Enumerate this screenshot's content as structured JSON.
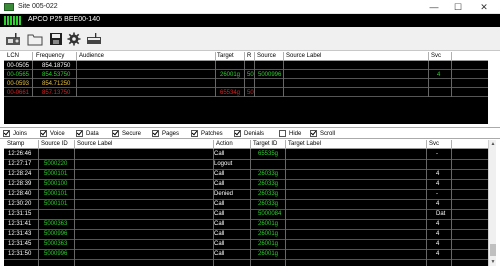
{
  "window": {
    "title": "Site 005-022",
    "minimize": "—",
    "maximize": "☐",
    "close": "✕"
  },
  "header": {
    "system": "APCO P25 BEE00-140"
  },
  "toolbar": {
    "buttons": [
      "radio-icon",
      "open-folder-icon",
      "save-disk-icon",
      "settings-gear-icon",
      "scanner-icon"
    ]
  },
  "channels": {
    "columns": [
      "LCN",
      "Frequency",
      "Audience",
      "Target",
      "R",
      "Source",
      "Source Label",
      "Svc"
    ],
    "rows": [
      {
        "lcn": "00-0505",
        "lcn_color": "#ffffff",
        "freq": "854.18750",
        "freq_color": "#ffffff",
        "target": "",
        "r": "",
        "source": "",
        "svc": "",
        "row_color": "#ffffff"
      },
      {
        "lcn": "00-0565",
        "lcn_color": "#2fd12f",
        "freq": "854.53750",
        "freq_color": "#2fd12f",
        "target": "26001g",
        "r": "50",
        "source": "5000996",
        "svc": "4",
        "row_color": "#2fd12f"
      },
      {
        "lcn": "00-0593",
        "lcn_color": "#e8c13a",
        "freq": "854.71250",
        "freq_color": "#e8c13a",
        "target": "",
        "r": "",
        "source": "",
        "svc": "",
        "row_color": "#e8c13a"
      },
      {
        "lcn": "00-0661",
        "lcn_color": "#e02020",
        "freq": "857.13750",
        "freq_color": "#e02020",
        "target": "65534g",
        "r": "50",
        "source": "",
        "svc": "",
        "row_color": "#e02020"
      }
    ]
  },
  "filters": [
    {
      "label": "Joins",
      "checked": true
    },
    {
      "label": "Voice",
      "checked": true
    },
    {
      "label": "Data",
      "checked": true
    },
    {
      "label": "Secure",
      "checked": true
    },
    {
      "label": "Pages",
      "checked": true
    },
    {
      "label": "Patches",
      "checked": true
    },
    {
      "label": "Denials",
      "checked": true
    },
    {
      "label": "Hide",
      "checked": false
    },
    {
      "label": "Scroll",
      "checked": true
    }
  ],
  "log": {
    "columns": [
      "Stamp",
      "Source ID",
      "Source Label",
      "Action",
      "Target ID",
      "Target Label",
      "Svc"
    ],
    "rows": [
      {
        "stamp": "12:26:46",
        "source": "",
        "action": "Call",
        "target": "65535g",
        "svc": "-"
      },
      {
        "stamp": "12:27:17",
        "source": "5000220",
        "action": "Logout",
        "target": "",
        "svc": ""
      },
      {
        "stamp": "12:28:24",
        "source": "5000101",
        "action": "Call",
        "target": "26033g",
        "svc": "4"
      },
      {
        "stamp": "12:28:39",
        "source": "5000100",
        "action": "Call",
        "target": "26033g",
        "svc": "4"
      },
      {
        "stamp": "12:28:40",
        "source": "5000101",
        "action": "Denied",
        "target": "26033g",
        "svc": "-"
      },
      {
        "stamp": "12:30:20",
        "source": "5000101",
        "action": "Call",
        "target": "26033g",
        "svc": "4"
      },
      {
        "stamp": "12:31:15",
        "source": "",
        "action": "Call",
        "target": "5000084",
        "svc": "Dat"
      },
      {
        "stamp": "12:31:41",
        "source": "5000363",
        "action": "Call",
        "target": "26001g",
        "svc": "4"
      },
      {
        "stamp": "12:31:43",
        "source": "5000996",
        "action": "Call",
        "target": "26001g",
        "svc": "4"
      },
      {
        "stamp": "12:31:45",
        "source": "5000363",
        "action": "Call",
        "target": "26001g",
        "svc": "4"
      },
      {
        "stamp": "12:31:50",
        "source": "5000996",
        "action": "Call",
        "target": "26001g",
        "svc": "4"
      }
    ]
  },
  "colors": {
    "green": "#2fd12f",
    "white": "#ffffff",
    "yellow": "#e8c13a",
    "red": "#e02020"
  }
}
